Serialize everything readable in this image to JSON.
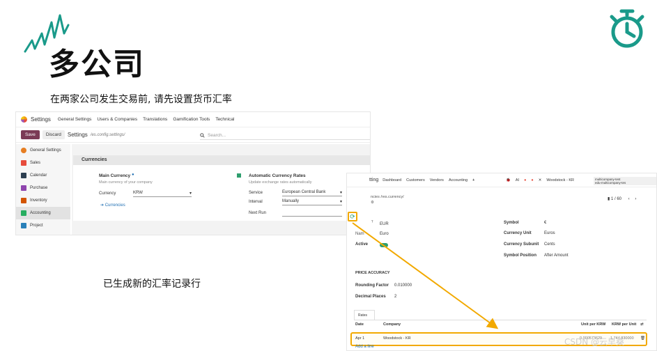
{
  "slide": {
    "title": "多公司",
    "caption_top": "在两家公司发生交易前, 请先设置货币汇率",
    "caption_bottom": "已生成新的汇率记录行",
    "watermark": "CSDN @云早桑",
    "accent_color": "#f2a900",
    "logo_color": "#1a9a8a"
  },
  "settings": {
    "app_name": "Settings",
    "nav": [
      "General Settings",
      "Users & Companies",
      "Translations",
      "Gamification Tools",
      "Technical"
    ],
    "save_label": "Save",
    "discard_label": "Discard",
    "breadcrumb": "Settings",
    "path": "/es.config.settings/",
    "search_placeholder": "Search...",
    "sidebar": [
      {
        "label": "General Settings",
        "color": "#e67e22"
      },
      {
        "label": "Sales",
        "color": "#e74c3c"
      },
      {
        "label": "Calendar",
        "color": "#2c3e50"
      },
      {
        "label": "Purchase",
        "color": "#8e44ad"
      },
      {
        "label": "Inventory",
        "color": "#d35400"
      },
      {
        "label": "Accounting",
        "color": "#27ae60"
      },
      {
        "label": "Project",
        "color": "#2980b9"
      }
    ],
    "section_title": "Currencies",
    "main_currency": {
      "title": "Main Currency",
      "desc": "Main currency of your company",
      "field_label": "Currency",
      "value": "KRW",
      "link": "➔ Currencies"
    },
    "auto_rates": {
      "title": "Automatic Currency Rates",
      "desc": "Update exchange rates automatically",
      "service_label": "Service",
      "service_value": "European Central Bank",
      "interval_label": "Interval",
      "interval_value": "Manually",
      "next_run_label": "Next Run"
    }
  },
  "currency_form": {
    "app_name": "tting",
    "nav": [
      "Dashboard",
      "Customers",
      "Vendors",
      "Accounting"
    ],
    "right_company": "Woodstock - KR",
    "company_tag_line1": "multicompany-test",
    "company_tag_line2": "edu-multicompany-tes",
    "breadcrumb": "ncies /res.currency/",
    "pager": "1 / 60",
    "fields_left": [
      {
        "label": "",
        "value": "EUR"
      },
      {
        "label": "Nam",
        "value": "Euro"
      },
      {
        "label": "Active",
        "value": ""
      }
    ],
    "fields_right": [
      {
        "label": "Symbol",
        "value": "€"
      },
      {
        "label": "Currency Unit",
        "value": "Euros"
      },
      {
        "label": "Currency Subunit",
        "value": "Cents"
      },
      {
        "label": "Symbol Position",
        "value": "After Amount"
      }
    ],
    "price_accuracy_title": "PRICE ACCURACY",
    "rounding_label": "Rounding Factor",
    "rounding_value": "0.010000",
    "decimal_label": "Decimal Places",
    "decimal_value": "2",
    "tab_label": "Rates",
    "table_headers": [
      "Date",
      "Company",
      "Unit per KRW",
      "KRW per Unit"
    ],
    "row": {
      "date": "Apr 1",
      "company": "Woodstock - KR",
      "unit_per": "0.000573629",
      "per_unit": "1,744.830000"
    },
    "add_line": "Add a line"
  }
}
